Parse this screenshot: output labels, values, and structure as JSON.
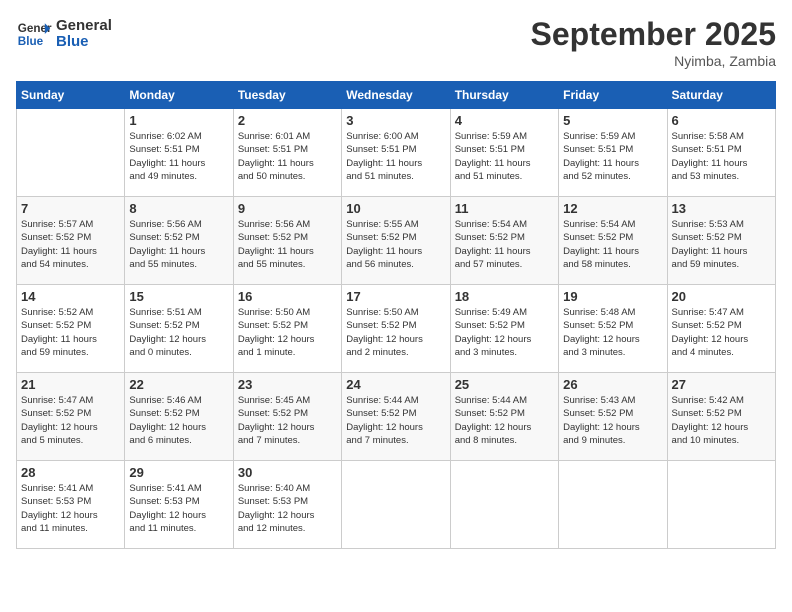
{
  "header": {
    "logo_line1": "General",
    "logo_line2": "Blue",
    "month": "September 2025",
    "location": "Nyimba, Zambia"
  },
  "days_of_week": [
    "Sunday",
    "Monday",
    "Tuesday",
    "Wednesday",
    "Thursday",
    "Friday",
    "Saturday"
  ],
  "weeks": [
    [
      {
        "num": "",
        "info": ""
      },
      {
        "num": "1",
        "info": "Sunrise: 6:02 AM\nSunset: 5:51 PM\nDaylight: 11 hours\nand 49 minutes."
      },
      {
        "num": "2",
        "info": "Sunrise: 6:01 AM\nSunset: 5:51 PM\nDaylight: 11 hours\nand 50 minutes."
      },
      {
        "num": "3",
        "info": "Sunrise: 6:00 AM\nSunset: 5:51 PM\nDaylight: 11 hours\nand 51 minutes."
      },
      {
        "num": "4",
        "info": "Sunrise: 5:59 AM\nSunset: 5:51 PM\nDaylight: 11 hours\nand 51 minutes."
      },
      {
        "num": "5",
        "info": "Sunrise: 5:59 AM\nSunset: 5:51 PM\nDaylight: 11 hours\nand 52 minutes."
      },
      {
        "num": "6",
        "info": "Sunrise: 5:58 AM\nSunset: 5:51 PM\nDaylight: 11 hours\nand 53 minutes."
      }
    ],
    [
      {
        "num": "7",
        "info": "Sunrise: 5:57 AM\nSunset: 5:52 PM\nDaylight: 11 hours\nand 54 minutes."
      },
      {
        "num": "8",
        "info": "Sunrise: 5:56 AM\nSunset: 5:52 PM\nDaylight: 11 hours\nand 55 minutes."
      },
      {
        "num": "9",
        "info": "Sunrise: 5:56 AM\nSunset: 5:52 PM\nDaylight: 11 hours\nand 55 minutes."
      },
      {
        "num": "10",
        "info": "Sunrise: 5:55 AM\nSunset: 5:52 PM\nDaylight: 11 hours\nand 56 minutes."
      },
      {
        "num": "11",
        "info": "Sunrise: 5:54 AM\nSunset: 5:52 PM\nDaylight: 11 hours\nand 57 minutes."
      },
      {
        "num": "12",
        "info": "Sunrise: 5:54 AM\nSunset: 5:52 PM\nDaylight: 11 hours\nand 58 minutes."
      },
      {
        "num": "13",
        "info": "Sunrise: 5:53 AM\nSunset: 5:52 PM\nDaylight: 11 hours\nand 59 minutes."
      }
    ],
    [
      {
        "num": "14",
        "info": "Sunrise: 5:52 AM\nSunset: 5:52 PM\nDaylight: 11 hours\nand 59 minutes."
      },
      {
        "num": "15",
        "info": "Sunrise: 5:51 AM\nSunset: 5:52 PM\nDaylight: 12 hours\nand 0 minutes."
      },
      {
        "num": "16",
        "info": "Sunrise: 5:50 AM\nSunset: 5:52 PM\nDaylight: 12 hours\nand 1 minute."
      },
      {
        "num": "17",
        "info": "Sunrise: 5:50 AM\nSunset: 5:52 PM\nDaylight: 12 hours\nand 2 minutes."
      },
      {
        "num": "18",
        "info": "Sunrise: 5:49 AM\nSunset: 5:52 PM\nDaylight: 12 hours\nand 3 minutes."
      },
      {
        "num": "19",
        "info": "Sunrise: 5:48 AM\nSunset: 5:52 PM\nDaylight: 12 hours\nand 3 minutes."
      },
      {
        "num": "20",
        "info": "Sunrise: 5:47 AM\nSunset: 5:52 PM\nDaylight: 12 hours\nand 4 minutes."
      }
    ],
    [
      {
        "num": "21",
        "info": "Sunrise: 5:47 AM\nSunset: 5:52 PM\nDaylight: 12 hours\nand 5 minutes."
      },
      {
        "num": "22",
        "info": "Sunrise: 5:46 AM\nSunset: 5:52 PM\nDaylight: 12 hours\nand 6 minutes."
      },
      {
        "num": "23",
        "info": "Sunrise: 5:45 AM\nSunset: 5:52 PM\nDaylight: 12 hours\nand 7 minutes."
      },
      {
        "num": "24",
        "info": "Sunrise: 5:44 AM\nSunset: 5:52 PM\nDaylight: 12 hours\nand 7 minutes."
      },
      {
        "num": "25",
        "info": "Sunrise: 5:44 AM\nSunset: 5:52 PM\nDaylight: 12 hours\nand 8 minutes."
      },
      {
        "num": "26",
        "info": "Sunrise: 5:43 AM\nSunset: 5:52 PM\nDaylight: 12 hours\nand 9 minutes."
      },
      {
        "num": "27",
        "info": "Sunrise: 5:42 AM\nSunset: 5:52 PM\nDaylight: 12 hours\nand 10 minutes."
      }
    ],
    [
      {
        "num": "28",
        "info": "Sunrise: 5:41 AM\nSunset: 5:53 PM\nDaylight: 12 hours\nand 11 minutes."
      },
      {
        "num": "29",
        "info": "Sunrise: 5:41 AM\nSunset: 5:53 PM\nDaylight: 12 hours\nand 11 minutes."
      },
      {
        "num": "30",
        "info": "Sunrise: 5:40 AM\nSunset: 5:53 PM\nDaylight: 12 hours\nand 12 minutes."
      },
      {
        "num": "",
        "info": ""
      },
      {
        "num": "",
        "info": ""
      },
      {
        "num": "",
        "info": ""
      },
      {
        "num": "",
        "info": ""
      }
    ]
  ]
}
